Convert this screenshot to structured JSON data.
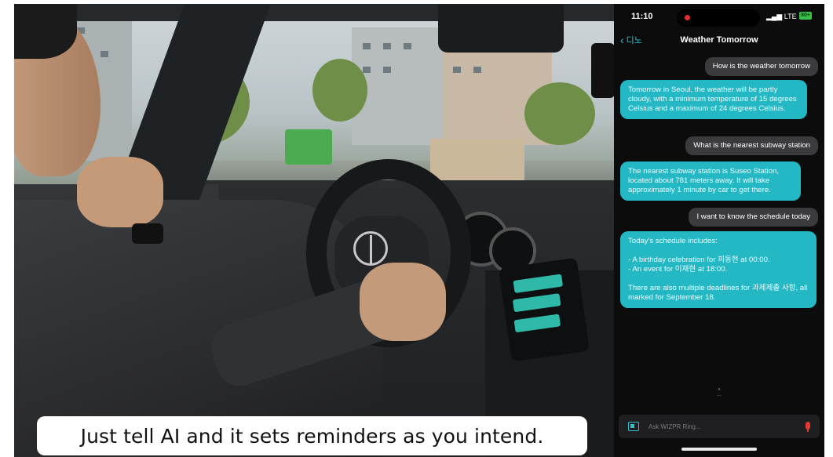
{
  "video": {
    "caption": "Just tell AI and it sets reminders as you intend."
  },
  "phone": {
    "status_bar": {
      "time": "11:10",
      "signal": "LTE",
      "battery": "80+"
    },
    "nav": {
      "back_label": "디노",
      "title": "Weather Tomorrow"
    },
    "messages": [
      {
        "role": "user",
        "text": "How is the weather tomorrow"
      },
      {
        "role": "ai",
        "text": "Tomorrow in Seoul, the weather will be partly cloudy, with a minimum temperature of 15 degrees Celsius and a maximum of 24 degrees Celsius."
      },
      {
        "role": "user",
        "text": "What is the nearest subway station"
      },
      {
        "role": "ai",
        "text": "The nearest subway station is Suseo Station, located about 781 meters away. It will take approximately 1 minute by car to get there."
      },
      {
        "role": "user",
        "text": "I want to know the schedule today"
      },
      {
        "role": "ai",
        "text": "Today's schedule includes:\n\n- A birthday celebration for 피동현 at 00:00.\n- An event for 이재현 at 18:00.\n\nThere are also multiple deadlines for 과제제출 사항, all marked for September 18."
      }
    ],
    "input": {
      "placeholder": "Ask WIZPR Ring..."
    }
  }
}
